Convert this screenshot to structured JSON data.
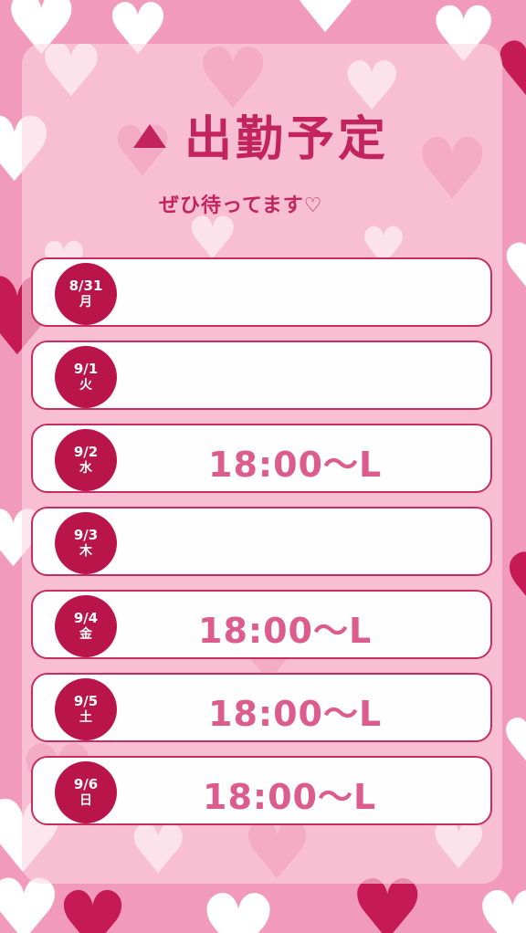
{
  "header": {
    "title": "出勤予定",
    "subtitle": "ぜひ待ってます♡"
  },
  "schedule": [
    {
      "date": "8/31",
      "weekday": "月",
      "time": ""
    },
    {
      "date": "9/1",
      "weekday": "火",
      "time": ""
    },
    {
      "date": "9/2",
      "weekday": "水",
      "time": "18:00～L"
    },
    {
      "date": "9/3",
      "weekday": "木",
      "time": ""
    },
    {
      "date": "9/4",
      "weekday": "金",
      "time": "18:00～L"
    },
    {
      "date": "9/5",
      "weekday": "土",
      "time": "18:00～L"
    },
    {
      "date": "9/6",
      "weekday": "日",
      "time": "18:00～L"
    }
  ],
  "theme": {
    "background": "#f29ab9",
    "accent": "#b9154b",
    "time_color": "#dc5d8d"
  },
  "icons": {
    "title_mark": "triangle-icon",
    "background": "heart-icon"
  }
}
